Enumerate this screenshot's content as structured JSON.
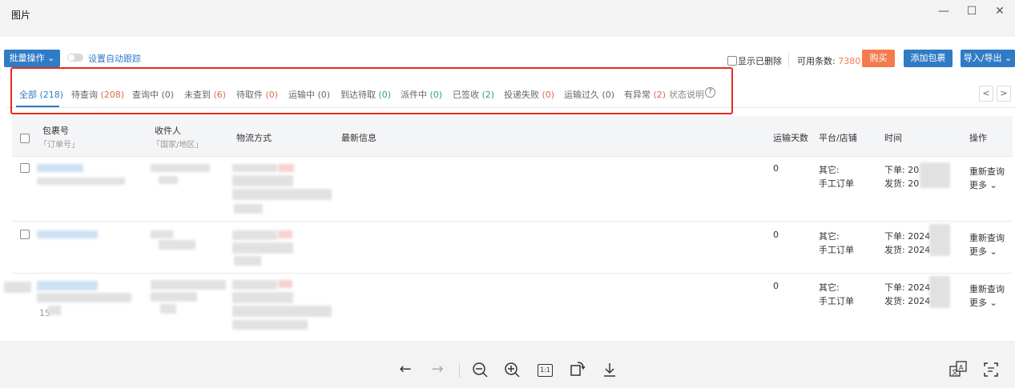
{
  "window": {
    "title": "图片",
    "minimize": "—",
    "maximize": "☐",
    "close": "✕"
  },
  "toolbar": {
    "batch_label": "批量操作",
    "auto_track_label": "设置自动跟踪",
    "show_deleted_label": "显示已删除",
    "available_label": "可用条数:",
    "available_value": "7380",
    "buy_label": "购买",
    "add_package_label": "添加包裹",
    "import_export_label": "导入/导出"
  },
  "tabs": [
    {
      "label": "全部",
      "count": "(218)"
    },
    {
      "label": "待查询",
      "count": "(208)"
    },
    {
      "label": "查询中",
      "count": "(0)"
    },
    {
      "label": "未查到",
      "count": "(6)"
    },
    {
      "label": "待取件",
      "count": "(0)"
    },
    {
      "label": "运输中",
      "count": "(0)"
    },
    {
      "label": "到达待取",
      "count": "(0)"
    },
    {
      "label": "派件中",
      "count": "(0)"
    },
    {
      "label": "已签收",
      "count": "(2)"
    },
    {
      "label": "投递失败",
      "count": "(0)"
    },
    {
      "label": "运输过久",
      "count": "(0)"
    },
    {
      "label": "有异常",
      "count": "(2)"
    }
  ],
  "status_help_label": "状态说明",
  "pager": {
    "prev": "<",
    "next": ">"
  },
  "table": {
    "headers": {
      "package_no": "包裹号",
      "order_no": "「订单号」",
      "recipient": "收件人",
      "region": "「国家/地区」",
      "logistics": "物流方式",
      "latest": "最新信息",
      "days": "运输天数",
      "platform": "平台/店铺",
      "time": "时间",
      "actions": "操作"
    },
    "rows": [
      {
        "days": "0",
        "platform1": "其它:",
        "platform2": "手工订单",
        "time1": "下单: 20",
        "time2": "发货: 20",
        "requery": "重新查询",
        "more": "更多"
      },
      {
        "days": "0",
        "platform1": "其它:",
        "platform2": "手工订单",
        "time1": "下单: 2024",
        "time2": "发货: 2024",
        "requery": "重新查询",
        "more": "更多"
      },
      {
        "days": "0",
        "platform1": "其它:",
        "platform2": "手工订单",
        "time1": "下单: 2024",
        "time2": "发货: 2024",
        "requery": "重新查询",
        "more": "更多",
        "extra": "15"
      }
    ]
  },
  "bottom_icons": [
    "back-arrow-icon",
    "forward-arrow-icon",
    "zoom-out-icon",
    "zoom-in-icon",
    "actual-size-icon",
    "rotate-icon",
    "download-icon",
    "translate-icon",
    "text-recognize-icon"
  ],
  "bottom": {
    "actual_size": "1:1"
  },
  "colors": {
    "accent": "#2f7cc6",
    "buy": "#f47b4d",
    "highlight_box": "#e52a22",
    "count_red": "#e0694a",
    "count_green": "#27a57a"
  }
}
